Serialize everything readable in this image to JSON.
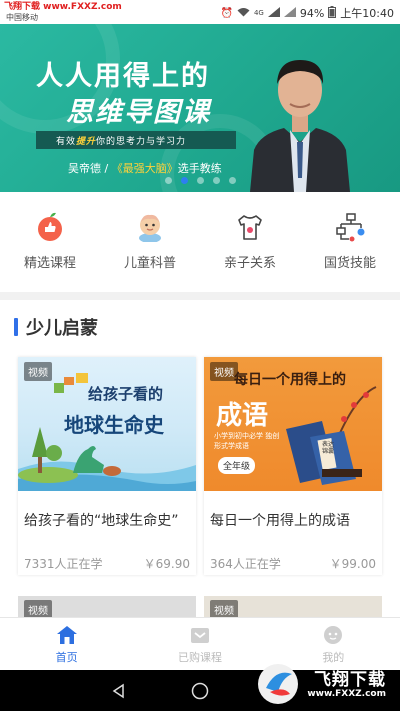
{
  "status_bar": {
    "watermark": "飞翔下载 www.FXXZ.com",
    "carrier": "中国移动",
    "signal": "4G",
    "battery": "94%",
    "time": "上午10:40"
  },
  "banner": {
    "title_line1": "人人用得上的",
    "title_line2": "思维导图课",
    "subtitle_pre": "有效",
    "subtitle_highlight": "提升",
    "subtitle_post": "你的思考力与学习力",
    "author_pre": "吴帝德 / ",
    "author_highlight": "《最强大脑》",
    "author_post": "选手教练",
    "slide_count": 5,
    "active_slide": 1
  },
  "categories": [
    {
      "label": "精选课程",
      "icon": "apple-thumb-icon"
    },
    {
      "label": "儿童科普",
      "icon": "child-face-icon"
    },
    {
      "label": "亲子关系",
      "icon": "tshirt-icon"
    },
    {
      "label": "国货技能",
      "icon": "flowchart-icon"
    }
  ],
  "section": {
    "title": "少儿启蒙",
    "cards": [
      {
        "badge": "视频",
        "cover_line1": "给孩子看的",
        "cover_line2": "地球生命史",
        "title": "给孩子看的“地球生命史”",
        "learners": "7331人正在学",
        "price": "￥69.90"
      },
      {
        "badge": "视频",
        "cover_line1": "每日一个用得上的",
        "cover_line2": "成语",
        "cover_note": "小学到初中必学 独创形式学成语",
        "cover_grade": "全年级",
        "book_label": "表达锦囊",
        "title": "每日一个用得上的成语",
        "learners": "364人正在学",
        "price": "￥99.00"
      }
    ],
    "next_badges": [
      "视频",
      "视频"
    ]
  },
  "tab_bar": {
    "tabs": [
      {
        "label": "首页",
        "icon": "home-icon",
        "active": true
      },
      {
        "label": "已购课程",
        "icon": "purchased-icon",
        "active": false
      },
      {
        "label": "我的",
        "icon": "profile-icon",
        "active": false
      }
    ]
  },
  "nav_watermark": {
    "text": "飞翔下载",
    "url": "www.FXXZ.com"
  },
  "colors": {
    "banner": "#2bb9a2",
    "accent": "#2d6fe0",
    "section_bar": "#3070e8",
    "highlight": "#ffd23a"
  }
}
